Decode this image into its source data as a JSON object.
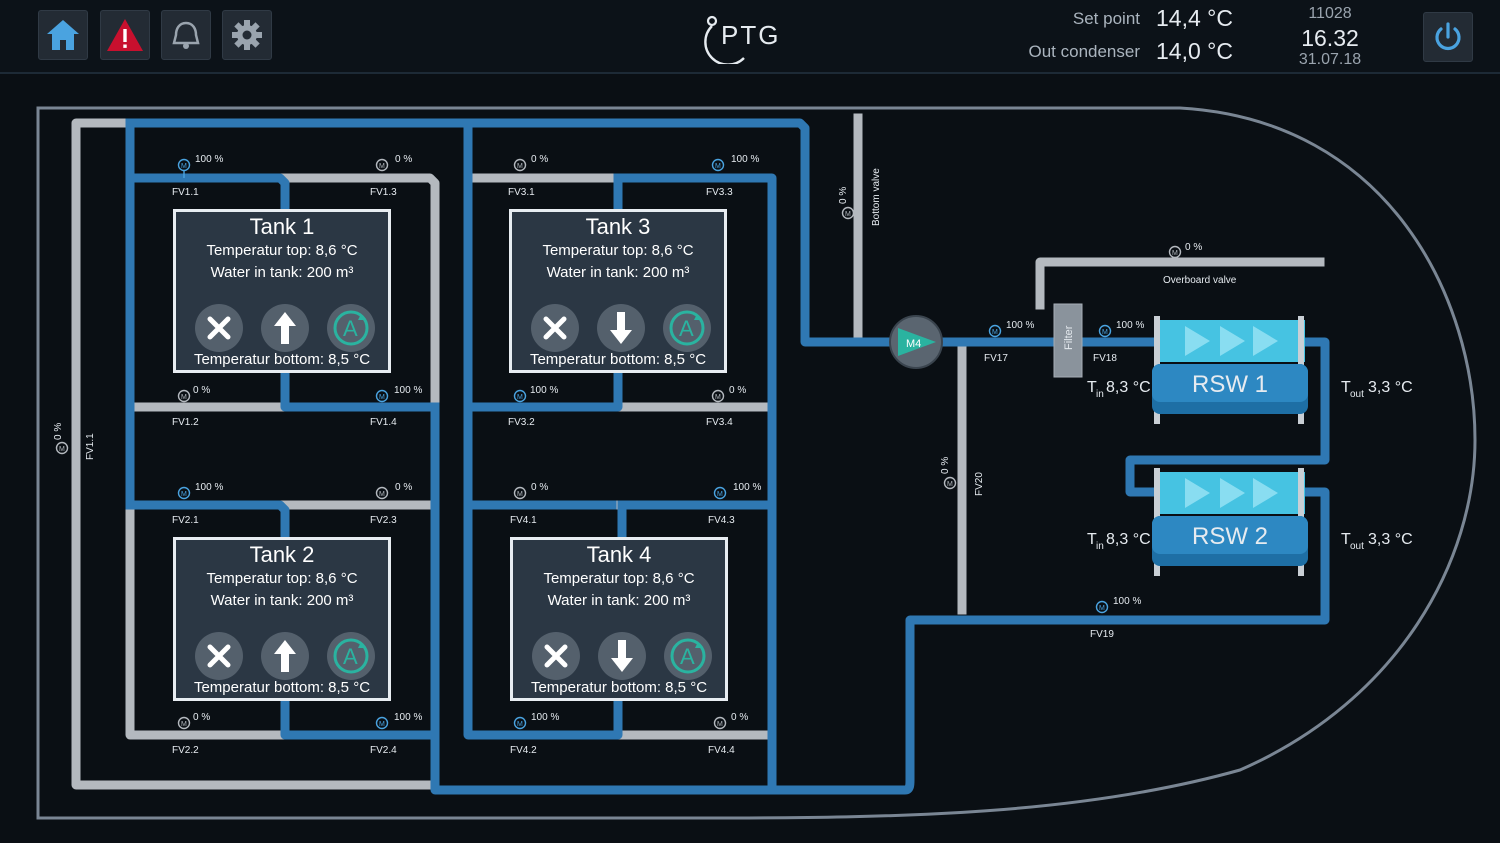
{
  "header": {
    "setpoint_label": "Set point",
    "setpoint_value": "14,4 °C",
    "condenser_label": "Out condenser",
    "condenser_value": "14,0 °C",
    "clock_id": "11028",
    "clock_time": "16.32",
    "clock_date": "31.07.18",
    "logo_text": "PTG"
  },
  "tanks": [
    {
      "title": "Tank 1",
      "temp_top": "Temperatur top:  8,6 °C",
      "water": "Water in tank: 200 m³",
      "temp_bottom": "Temperatur bottom: 8,5 °C",
      "arrow": "up"
    },
    {
      "title": "Tank 2",
      "temp_top": "Temperatur top:  8,6 °C",
      "water": "Water in tank: 200 m³",
      "temp_bottom": "Temperatur bottom: 8,5 °C",
      "arrow": "up"
    },
    {
      "title": "Tank 3",
      "temp_top": "Temperatur top:  8,6 °C",
      "water": "Water in tank: 200 m³",
      "temp_bottom": "Temperatur bottom: 8,5 °C",
      "arrow": "down"
    },
    {
      "title": "Tank 4",
      "temp_top": "Temperatur top:  8,6 °C",
      "water": "Water in tank: 200 m³",
      "temp_bottom": "Temperatur bottom: 8,5 °C",
      "arrow": "down"
    }
  ],
  "valves": {
    "fv1_1": {
      "name": "FV1.1",
      "pct": "100 %"
    },
    "fv1_3": {
      "name": "FV1.3",
      "pct": "0 %"
    },
    "fv1_2": {
      "name": "FV1.2",
      "pct": "0 %"
    },
    "fv1_4": {
      "name": "FV1.4",
      "pct": "100 %"
    },
    "fv2_1": {
      "name": "FV2.1",
      "pct": "100 %"
    },
    "fv2_3": {
      "name": "FV2.3",
      "pct": "0 %"
    },
    "fv2_2": {
      "name": "FV2.2",
      "pct": "0 %"
    },
    "fv2_4": {
      "name": "FV2.4",
      "pct": "100 %"
    },
    "fv3_1": {
      "name": "FV3.1",
      "pct": "0 %"
    },
    "fv3_3": {
      "name": "FV3.3",
      "pct": "100 %"
    },
    "fv3_2": {
      "name": "FV3.2",
      "pct": "100 %"
    },
    "fv3_4": {
      "name": "FV3.4",
      "pct": "0 %"
    },
    "fv4_1": {
      "name": "FV4.1",
      "pct": "0 %"
    },
    "fv4_3": {
      "name": "FV4.3",
      "pct": "100 %"
    },
    "fv4_2": {
      "name": "FV4.2",
      "pct": "100 %"
    },
    "fv4_4": {
      "name": "FV4.4",
      "pct": "0 %"
    },
    "fv17": {
      "name": "FV17",
      "pct": "100 %"
    },
    "fv18": {
      "name": "FV18",
      "pct": "100 %"
    },
    "fv19": {
      "name": "FV19",
      "pct": "100 %"
    },
    "fv20": {
      "name": "FV20",
      "pct": "0 %"
    },
    "fv1_1_side": {
      "name": "FV1.1",
      "pct": "0 %"
    },
    "bottom": {
      "name": "Bottom valve",
      "pct": "0 %"
    },
    "overboard": {
      "name": "Overboard valve",
      "pct": "0 %"
    }
  },
  "pump_label": "M4",
  "filter_label": "Filter",
  "rsw": [
    {
      "name": "RSW 1",
      "tin_label": "T",
      "tin_sub": "in",
      "tin_val": "8,3 °C",
      "tout_label": "T",
      "tout_sub": "out",
      "tout_val": "3,3 °C"
    },
    {
      "name": "RSW 2",
      "tin_label": "T",
      "tin_sub": "in",
      "tin_val": "8,3 °C",
      "tout_label": "T",
      "tout_sub": "out",
      "tout_val": "3,3 °C"
    }
  ],
  "colors": {
    "active_pipe": "#2f78b3",
    "idle_pipe": "#b4b9bf",
    "accent": "#2ab3a0",
    "alert": "#c8102e"
  }
}
